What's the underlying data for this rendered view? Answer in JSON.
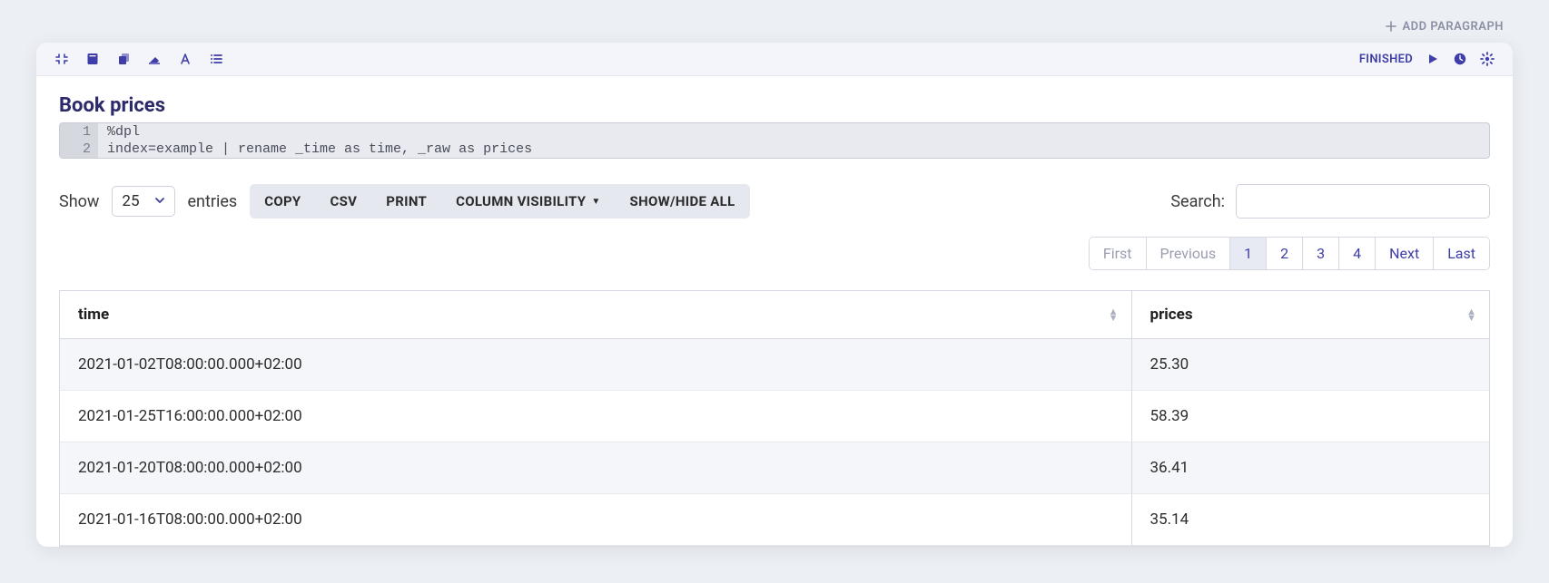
{
  "addParagraph": {
    "label": "ADD PARAGRAPH"
  },
  "toolbar": {
    "status": "FINISHED"
  },
  "paragraph": {
    "title": "Book prices",
    "code": [
      {
        "num": "1",
        "text": "%dpl"
      },
      {
        "num": "2",
        "text": "index=example | rename _time as time, _raw as prices"
      }
    ]
  },
  "controls": {
    "showLabel": "Show",
    "entriesLabel": "entries",
    "pageSize": "25",
    "buttons": {
      "copy": "COPY",
      "csv": "CSV",
      "print": "PRINT",
      "colvis": "COLUMN VISIBILITY",
      "toggleAll": "SHOW/HIDE ALL"
    },
    "searchLabel": "Search:",
    "searchValue": ""
  },
  "pager": {
    "first": "First",
    "previous": "Previous",
    "pages": [
      "1",
      "2",
      "3",
      "4"
    ],
    "next": "Next",
    "last": "Last",
    "activeIndex": 0
  },
  "table": {
    "columns": [
      "time",
      "prices"
    ],
    "rows": [
      {
        "time": "2021-01-02T08:00:00.000+02:00",
        "prices": "25.30"
      },
      {
        "time": "2021-01-25T16:00:00.000+02:00",
        "prices": "58.39"
      },
      {
        "time": "2021-01-20T08:00:00.000+02:00",
        "prices": "36.41"
      },
      {
        "time": "2021-01-16T08:00:00.000+02:00",
        "prices": "35.14"
      }
    ]
  }
}
